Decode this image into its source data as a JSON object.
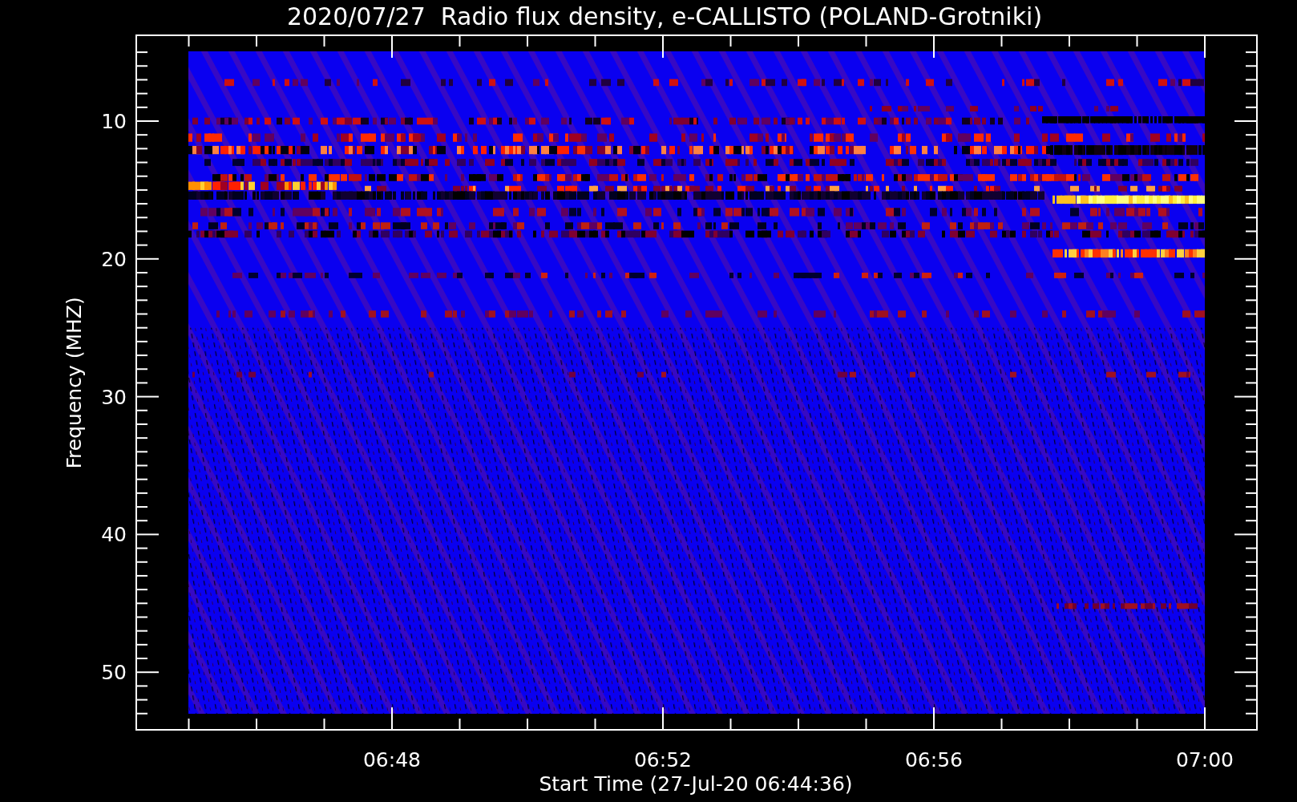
{
  "title": "2020/07/27  Radio flux density, e-CALLISTO (POLAND-Grotniki)",
  "y_axis": {
    "label": "Frequency (MHZ)",
    "ticks": [
      "10",
      "20",
      "30",
      "40",
      "50"
    ]
  },
  "x_axis": {
    "label": "Start Time (27-Jul-20 06:44:36)",
    "ticks": [
      "06:48",
      "06:52",
      "06:56",
      "07:00"
    ]
  }
}
